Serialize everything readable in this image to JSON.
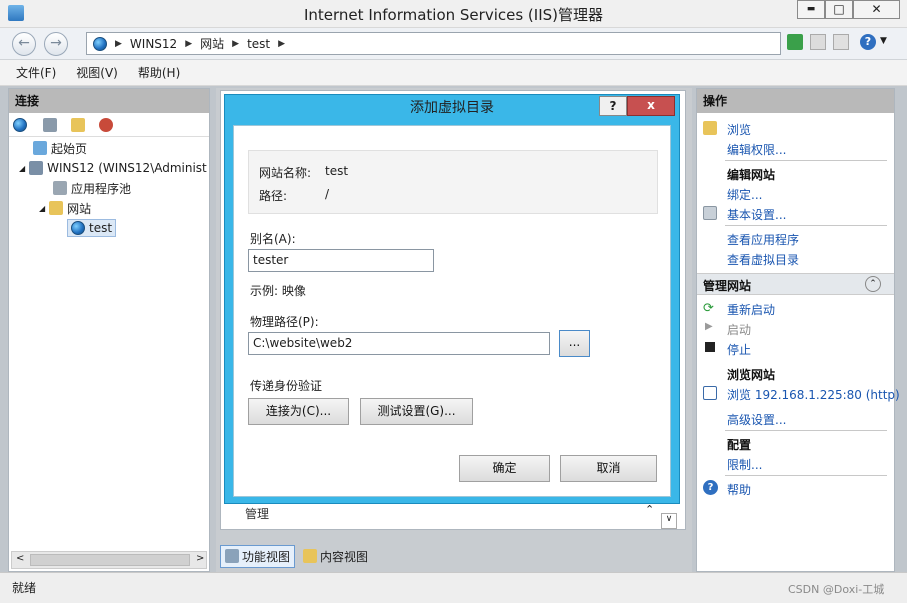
{
  "window": {
    "title": "Internet Information Services (IIS)管理器",
    "min": "▬",
    "max": "□",
    "close": "✕"
  },
  "address": {
    "crumbs": [
      "WINS12",
      "网站",
      "test"
    ]
  },
  "menu": [
    "文件(F)",
    "视图(V)",
    "帮助(H)"
  ],
  "connections": {
    "title": "连接",
    "tree": [
      "起始页",
      "WINS12 (WINS12\\Administ",
      "应用程序池",
      "网站",
      "test"
    ]
  },
  "center": {
    "bottom_tabs": [
      "功能视图",
      "内容视图"
    ],
    "hidden_text": "管理"
  },
  "actions": {
    "title": "操作",
    "browse": "浏览",
    "edit_perm": "编辑权限...",
    "edit_site_head": "编辑网站",
    "bind": "绑定...",
    "basic": "基本设置...",
    "view_apps": "查看应用程序",
    "view_vdirs": "查看虚拟目录",
    "manage_head": "管理网站",
    "restart": "重新启动",
    "start": "启动",
    "stop": "停止",
    "browse_head": "浏览网站",
    "browse_url": "浏览 192.168.1.225:80 (http)",
    "advanced": "高级设置...",
    "config_head": "配置",
    "limits": "限制...",
    "help": "帮助"
  },
  "dialog": {
    "title": "添加虚拟目录",
    "help_btn": "?",
    "close_btn": "x",
    "site_label": "网站名称:",
    "site_value": "test",
    "path_label": "路径:",
    "path_value": "/",
    "alias_label": "别名(A):",
    "alias_value": "tester",
    "example": "示例: 映像",
    "phys_label": "物理路径(P):",
    "phys_value": "C:\\website\\web2",
    "browse_btn": "...",
    "auth_label": "传递身份验证",
    "connect_as": "连接为(C)...",
    "test_settings": "测试设置(G)...",
    "ok": "确定",
    "cancel": "取消"
  },
  "status": {
    "text": "就绪",
    "watermark": "CSDN @Doxi-工城"
  }
}
